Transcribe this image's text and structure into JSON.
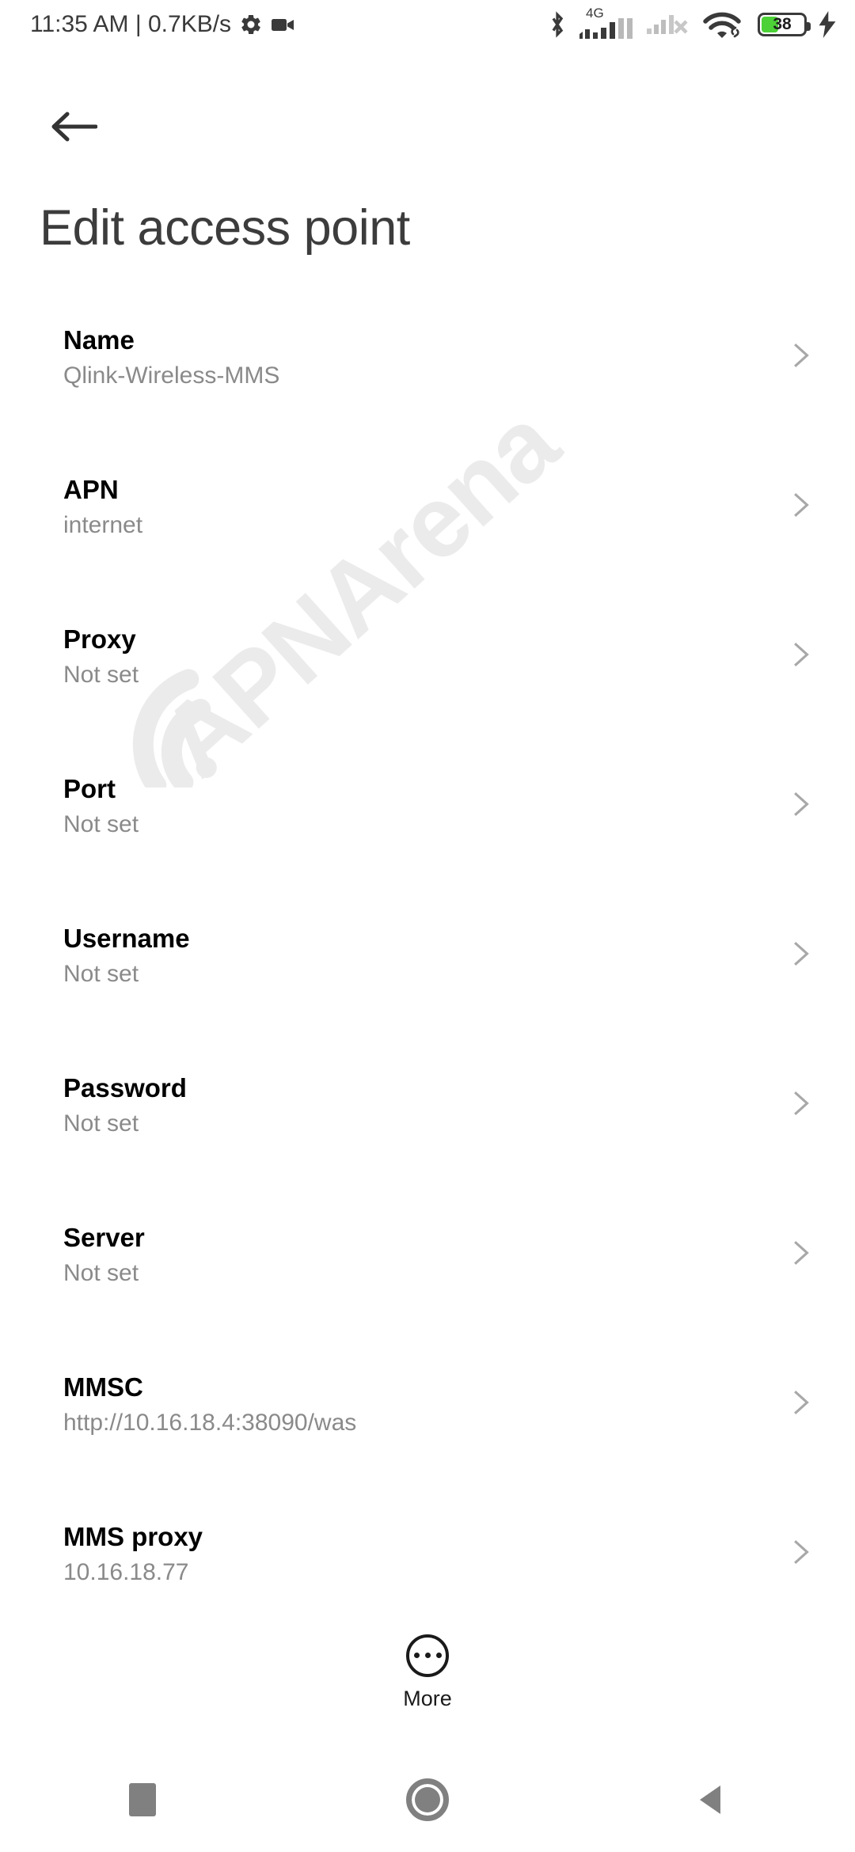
{
  "statusbar": {
    "clock": "11:35 AM | 0.7KB/s",
    "icons": {
      "settings": "gear-icon",
      "recording": "video-camera-icon",
      "bluetooth": "bluetooth-icon",
      "network_type": "4G",
      "signal_sim1": "signal-bars-icon",
      "signal_sim2": "signal-bars-no-service-icon",
      "wifi": "wifi-icon",
      "vpn": "link-icon",
      "battery": "battery-icon",
      "charging": "charging-bolt-icon"
    },
    "battery_level": "38",
    "battery_percent": 38,
    "battery_color": "#4cd137"
  },
  "header": {
    "back_icon": "arrow-left-icon",
    "title": "Edit access point"
  },
  "watermark": {
    "text": "APNArena",
    "color": "#ebebeb"
  },
  "list": {
    "chevron_icon": "chevron-right-icon",
    "rows": [
      {
        "label": "Name",
        "value": "Qlink-Wireless-MMS"
      },
      {
        "label": "APN",
        "value": "internet"
      },
      {
        "label": "Proxy",
        "value": "Not set"
      },
      {
        "label": "Port",
        "value": "Not set"
      },
      {
        "label": "Username",
        "value": "Not set"
      },
      {
        "label": "Password",
        "value": "Not set"
      },
      {
        "label": "Server",
        "value": "Not set"
      },
      {
        "label": "MMSC",
        "value": "http://10.16.18.4:38090/was"
      },
      {
        "label": "MMS proxy",
        "value": "10.16.18.77"
      }
    ]
  },
  "more": {
    "icon": "more-circle-icon",
    "label": "More"
  },
  "navbar": {
    "recents_icon": "square-icon",
    "home_icon": "circle-icon",
    "back_icon": "triangle-left-icon"
  }
}
